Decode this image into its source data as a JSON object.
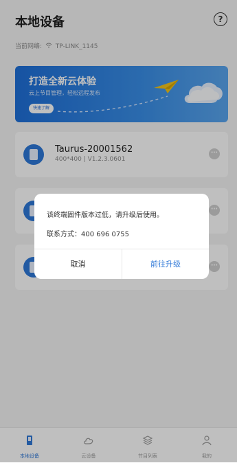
{
  "header": {
    "title": "本地设备",
    "help_icon": "?"
  },
  "network": {
    "prefix": "当前网络:",
    "ssid": "TP-LINK_1145"
  },
  "banner": {
    "title": "打造全新云体验",
    "subtitle": "云上节目管理，轻松远程发布",
    "button": "快速了解",
    "colors": {
      "start": "#1e6fd9",
      "end": "#5aa6ef"
    }
  },
  "devices": [
    {
      "name": "Taurus-20001562",
      "meta": "400*400 | V1.2.3.0601"
    },
    {
      "name": "",
      "meta": ""
    },
    {
      "name": "",
      "meta": ""
    }
  ],
  "dialog": {
    "message": "该终端固件版本过低，请升级后使用。",
    "contact": "联系方式：400 696 0755",
    "cancel": "取消",
    "confirm": "前往升级",
    "confirm_color": "#2f78d7"
  },
  "nav": [
    {
      "label": "本地设备",
      "icon": "device-icon",
      "active": true
    },
    {
      "label": "云设备",
      "icon": "cloud-icon",
      "active": false
    },
    {
      "label": "节目列表",
      "icon": "layers-icon",
      "active": false
    },
    {
      "label": "我的",
      "icon": "user-icon",
      "active": false
    }
  ]
}
